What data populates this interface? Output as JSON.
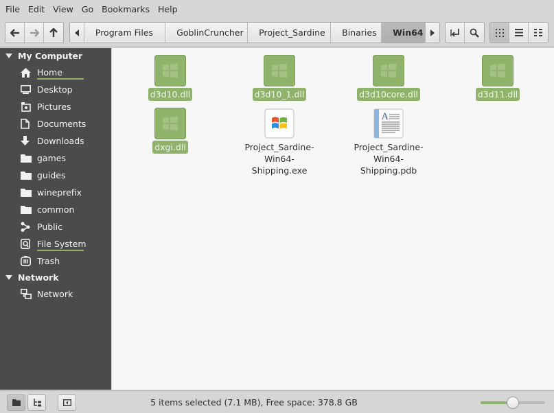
{
  "menubar": {
    "items": [
      "File",
      "Edit",
      "View",
      "Go",
      "Bookmarks",
      "Help"
    ]
  },
  "toolbar": {
    "nav_icons": [
      "back-arrow-icon",
      "forward-arrow-icon",
      "up-arrow-icon"
    ],
    "breadcrumbs": [
      "Program Files",
      "GoblinCruncher",
      "Project_Sardine",
      "Binaries",
      "Win64"
    ],
    "current_crumb_index": 4,
    "view_modes": [
      "icon-view",
      "list-view",
      "compact-view"
    ],
    "active_view": "icon-view"
  },
  "sidebar": {
    "sections": [
      {
        "title": "My Computer",
        "items": [
          {
            "label": "Home",
            "icon": "home-icon",
            "usage_bar": true
          },
          {
            "label": "Desktop",
            "icon": "desktop-icon"
          },
          {
            "label": "Pictures",
            "icon": "pictures-icon"
          },
          {
            "label": "Documents",
            "icon": "documents-icon"
          },
          {
            "label": "Downloads",
            "icon": "downloads-icon"
          },
          {
            "label": "games",
            "icon": "folder-icon"
          },
          {
            "label": "guides",
            "icon": "folder-icon"
          },
          {
            "label": "wineprefix",
            "icon": "folder-icon"
          },
          {
            "label": "common",
            "icon": "folder-icon"
          },
          {
            "label": "Public",
            "icon": "share-icon"
          },
          {
            "label": "File System",
            "icon": "drive-icon",
            "usage_bar": true
          },
          {
            "label": "Trash",
            "icon": "trash-icon"
          }
        ]
      },
      {
        "title": "Network",
        "items": [
          {
            "label": "Network",
            "icon": "network-icon"
          }
        ]
      }
    ]
  },
  "files": [
    {
      "name": "d3d10.dll",
      "icon": "dll-icon",
      "selected": true
    },
    {
      "name": "d3d10_1.dll",
      "icon": "dll-icon",
      "selected": true
    },
    {
      "name": "d3d10core.dll",
      "icon": "dll-icon",
      "selected": true
    },
    {
      "name": "d3d11.dll",
      "icon": "dll-icon",
      "selected": true
    },
    {
      "name": "dxgi.dll",
      "icon": "dll-icon",
      "selected": true
    },
    {
      "name": "Project_Sardine-Win64-Shipping.exe",
      "name_lines": [
        "Project_Sardine-Win64-",
        "Shipping.exe"
      ],
      "icon": "windows-exe-icon",
      "selected": false
    },
    {
      "name": "Project_Sardine-Win64-Shipping.pdb",
      "name_lines": [
        "Project_Sardine-Win64-",
        "Shipping.pdb"
      ],
      "icon": "document-icon",
      "selected": false
    }
  ],
  "statusbar": {
    "text": "5 items selected (7.1 MB), Free space: 378.8 GB",
    "zoom_level": 0.5,
    "buttons": [
      "places-icon",
      "tree-icon",
      "toggle-sidebar-icon"
    ]
  },
  "colors": {
    "selection": "#8fb36a",
    "sidebar_bg": "#4b4b4b",
    "content_bg": "#f7f7f7",
    "chrome_bg": "#d6d6d6"
  }
}
